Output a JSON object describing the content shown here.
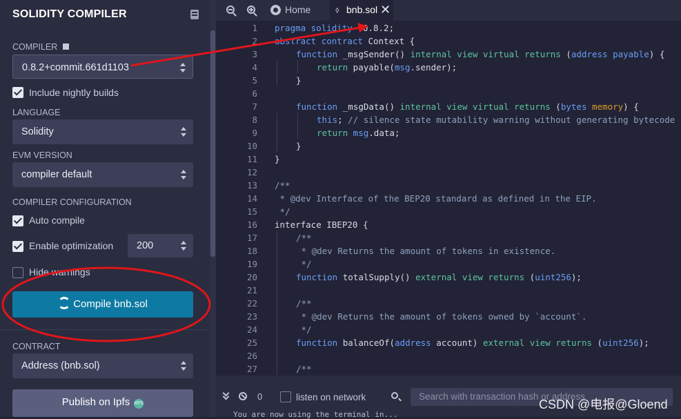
{
  "sidebar": {
    "title": "SOLIDITY COMPILER",
    "compiler_label": "COMPILER",
    "compiler_value": "0.8.2+commit.661d1103",
    "nightly_label": "Include nightly builds",
    "language_label": "LANGUAGE",
    "language_value": "Solidity",
    "evm_label": "EVM VERSION",
    "evm_value": "compiler default",
    "config_label": "COMPILER CONFIGURATION",
    "auto_compile_label": "Auto compile",
    "optimization_label": "Enable optimization",
    "optimization_runs": "200",
    "hide_warnings_label": "Hide warnings",
    "compile_label": "Compile bnb.sol",
    "contract_label": "CONTRACT",
    "contract_value": "Address (bnb.sol)",
    "publish_label": "Publish on Ipfs",
    "ipfs_badge": "IPFS"
  },
  "tabs": {
    "home": "Home",
    "file": "bnb.sol",
    "file_icon": "solidity-icon"
  },
  "editor": {
    "lines": [
      {
        "n": "1"
      },
      {
        "n": "2"
      },
      {
        "n": "3"
      },
      {
        "n": "4"
      },
      {
        "n": "5"
      },
      {
        "n": "6"
      },
      {
        "n": "7"
      },
      {
        "n": "8"
      },
      {
        "n": "9"
      },
      {
        "n": "10"
      },
      {
        "n": "11"
      },
      {
        "n": "12"
      },
      {
        "n": "13"
      },
      {
        "n": "14"
      },
      {
        "n": "15"
      },
      {
        "n": "16"
      },
      {
        "n": "17"
      },
      {
        "n": "18"
      },
      {
        "n": "19"
      },
      {
        "n": "20"
      },
      {
        "n": "21"
      },
      {
        "n": "22"
      },
      {
        "n": "23"
      },
      {
        "n": "24"
      },
      {
        "n": "25"
      },
      {
        "n": "26"
      },
      {
        "n": "27"
      }
    ],
    "code": {
      "l1a": "pragma solidity",
      "l1b": " ^0.8.2;",
      "l2a": "abstract contract",
      "l2b": " Context {",
      "l3a": "function",
      "l3b": " _msgSender() ",
      "l3c": "internal view virtual returns",
      "l3d": " (",
      "l3e": "address payable",
      "l3f": ") {",
      "l4a": "return",
      "l4b": " payable(",
      "l4c": "msg",
      "l4d": ".sender);",
      "l5": "}",
      "l7a": "function",
      "l7b": " _msgData() ",
      "l7c": "internal view virtual returns",
      "l7d": " (",
      "l7e": "bytes",
      "l7f": " memory",
      "l7g": ") {",
      "l8a": "this",
      "l8b": "; ",
      "l8c": "// silence state mutability warning without generating bytecode",
      "l9a": "return",
      "l9b": " msg",
      "l9c": ".data;",
      "l10": "}",
      "l11": "}",
      "l13": "/**",
      "l14": " * @dev Interface of the BEP20 standard as defined in the EIP.",
      "l15": " */",
      "l16a": "interface",
      "l16b": " IBEP20 {",
      "l17": "/**",
      "l18": " * @dev Returns the amount of tokens in existence.",
      "l19": " */",
      "l20a": "function",
      "l20b": " totalSupply() ",
      "l20c": "external view returns",
      "l20d": " (",
      "l20e": "uint256",
      "l20f": ");",
      "l22": "/**",
      "l23": " * @dev Returns the amount of tokens owned by `account`.",
      "l24": " */",
      "l25a": "function",
      "l25b": " balanceOf(",
      "l25c": "address",
      "l25d": " account) ",
      "l25e": "external view returns",
      "l25f": " (",
      "l25g": "uint256",
      "l25h": ");",
      "l27": "/**"
    }
  },
  "terminal": {
    "count": "0",
    "listen_label": "listen on network",
    "search_placeholder": "Search with transaction hash or address",
    "output": "You are now using the terminal in..."
  },
  "watermark": "CSDN @电报@Gloend",
  "colors": {
    "accent": "#0e7aa3",
    "annotation": "#e0161b"
  }
}
